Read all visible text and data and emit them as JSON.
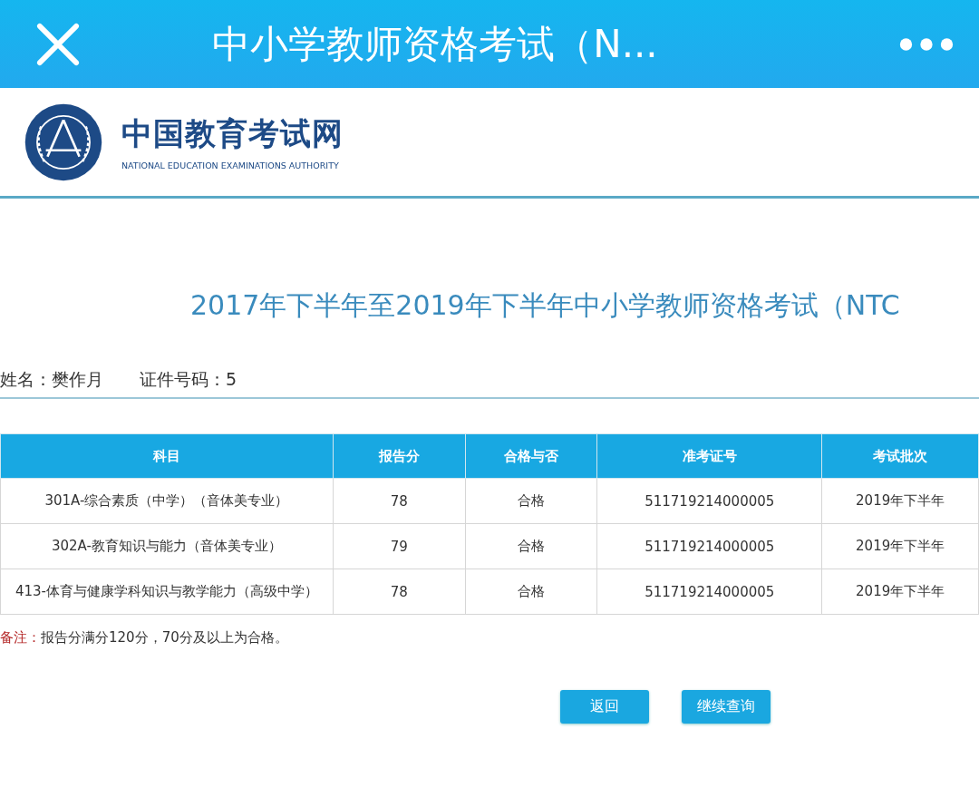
{
  "top_bar": {
    "title": "中小学教师资格考试（N..."
  },
  "logo": {
    "name": "中国教育考试网",
    "subtitle": "NATIONAL EDUCATION EXAMINATIONS AUTHORITY"
  },
  "heading": "2017年下半年至2019年下半年中小学教师资格考试（NTC",
  "candidate": {
    "name_label": "姓名：樊作月",
    "id_label": "证件号码：5"
  },
  "table": {
    "columns": [
      "科目",
      "报告分",
      "合格与否",
      "准考证号",
      "考试批次"
    ],
    "rows": [
      [
        "301A-综合素质（中学）（音体美专业）",
        "78",
        "合格",
        "511719214000005",
        "2019年下半年"
      ],
      [
        "302A-教育知识与能力（音体美专业）",
        "79",
        "合格",
        "511719214000005",
        "2019年下半年"
      ],
      [
        "413-体育与健康学科知识与教学能力（高级中学）",
        "78",
        "合格",
        "511719214000005",
        "2019年下半年"
      ]
    ]
  },
  "note": {
    "label": "备注：",
    "text": "报告分满分120分，70分及以上为合格。"
  },
  "buttons": [
    "返回",
    "继续查询"
  ]
}
